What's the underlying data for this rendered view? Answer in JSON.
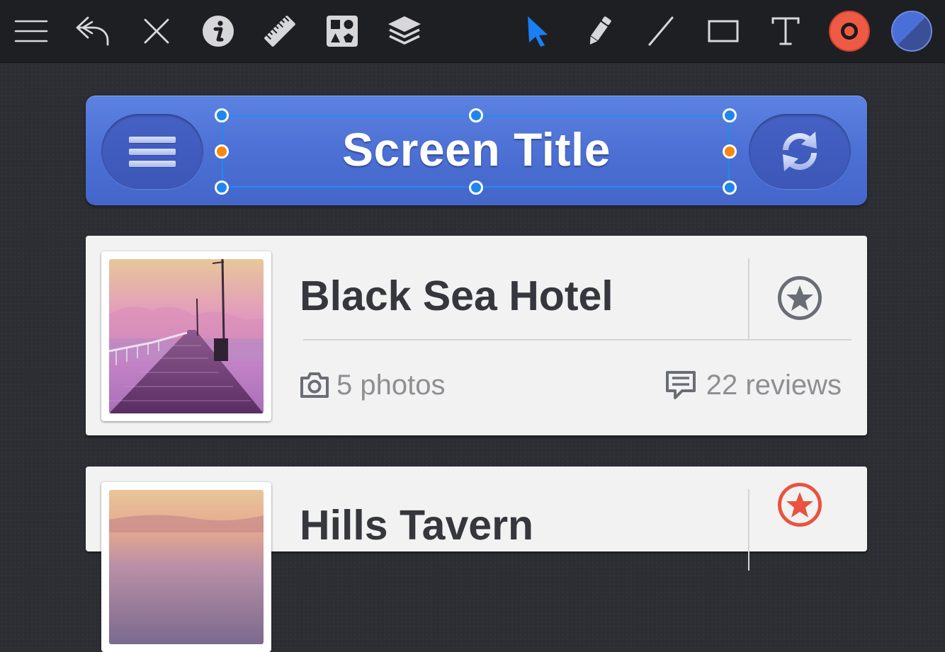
{
  "toolbar": {
    "tools": [
      {
        "name": "menu-icon"
      },
      {
        "name": "undo-icon"
      },
      {
        "name": "close-icon"
      },
      {
        "name": "info-icon"
      },
      {
        "name": "ruler-icon"
      },
      {
        "name": "shapes-library-icon"
      },
      {
        "name": "layers-icon"
      },
      {
        "name": "select-arrow-icon",
        "active": true
      },
      {
        "name": "pencil-icon"
      },
      {
        "name": "line-icon"
      },
      {
        "name": "rectangle-icon"
      },
      {
        "name": "text-icon"
      }
    ],
    "colors": {
      "stroke": "#ef5a45",
      "fill": "#4a6fd8",
      "active_tool": "#1a7ff2"
    }
  },
  "navbar": {
    "title": "Screen Title",
    "left_icon": "hamburger-icon",
    "right_icon": "refresh-icon",
    "color": "#4f74d8"
  },
  "selection": {
    "handle_color": "#1f86ee",
    "side_handle_color": "#f5890e"
  },
  "cards": [
    {
      "title": "Black Sea Hotel",
      "photos": "5 photos",
      "reviews": "22 reviews",
      "favorite": false,
      "star_color": "#6b6d75"
    },
    {
      "title": "Hills Tavern",
      "favorite": true,
      "star_color": "#e9533f"
    }
  ]
}
